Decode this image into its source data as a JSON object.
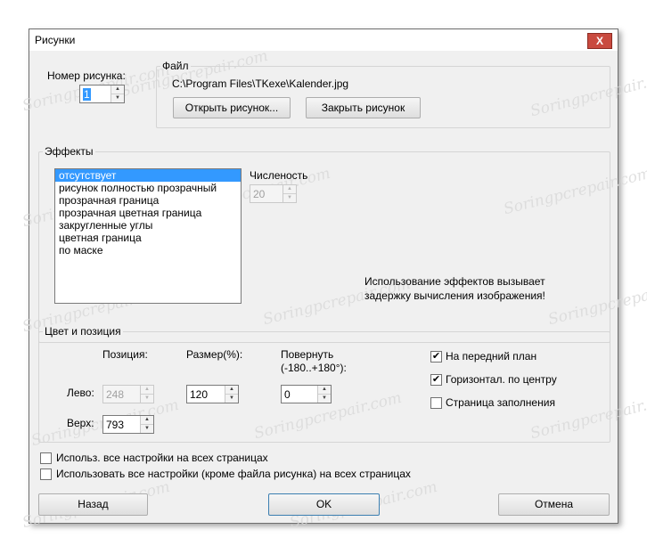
{
  "window": {
    "title": "Рисунки",
    "close_glyph": "X"
  },
  "image_number": {
    "label": "Номер рисунка:",
    "value": "1"
  },
  "file": {
    "legend": "Файл",
    "path": "C:\\Program Files\\TKexe\\Kalender.jpg",
    "open_label": "Открыть рисунок...",
    "close_label": "Закрыть рисунок"
  },
  "effects": {
    "legend": "Эффекты",
    "items": [
      "отсутствует",
      "рисунок полностью прозрачный",
      "прозрачная граница",
      "прозрачная цветная граница",
      "закругленные углы",
      "цветная граница",
      "по маске"
    ],
    "selected_index": 0,
    "strength_label": "Численость",
    "strength_value": "20",
    "note_line1": "Использование эффектов вызывает",
    "note_line2": "задержку вычисления изображения!"
  },
  "color_position": {
    "legend": "Цвет и позиция",
    "position_label": "Позиция:",
    "size_label": "Размер(%):",
    "rotate_label_line1": "Повернуть",
    "rotate_label_line2": "(-180..+180°):",
    "left_label": "Лево:",
    "left_value": "248",
    "top_label": "Верх:",
    "top_value": "793",
    "size_value": "120",
    "rotate_value": "0",
    "foreground_label": "На передний план",
    "foreground_checked": true,
    "center_label": "Горизонтал. по центру",
    "center_checked": true,
    "fill_label": "Страница заполнения",
    "fill_checked": false
  },
  "options": {
    "apply_all_label": "Использ. все настройки на всех страницах",
    "apply_all_checked": false,
    "apply_all_except_label": "Использовать все настройки (кроме файла рисунка) на всех страницах",
    "apply_all_except_checked": false
  },
  "buttons": {
    "back": "Назад",
    "ok": "OK",
    "cancel": "Отмена"
  },
  "watermark": "Soringpcrepair.com",
  "check_glyph": "✔",
  "arrow_up": "▲",
  "arrow_down": "▼"
}
